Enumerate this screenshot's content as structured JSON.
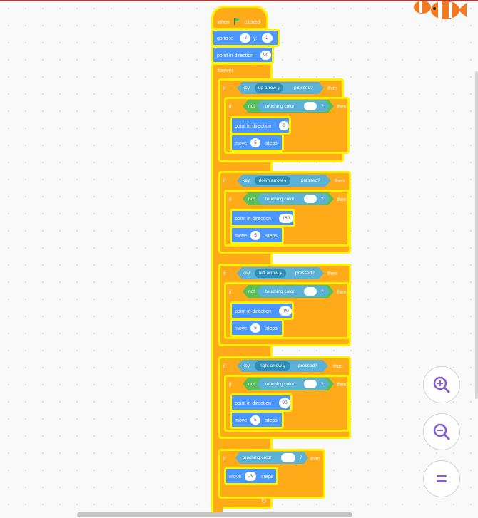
{
  "sprite": {
    "icon": "clownfish-icon"
  },
  "script": {
    "hat": {
      "when": "when",
      "flag_icon": "green-flag-icon",
      "clicked": "clicked"
    },
    "goto": {
      "label_x": "go to x:",
      "x": "-7",
      "label_y": "y:",
      "y": "2"
    },
    "point0": {
      "label": "point in direction",
      "value": "90"
    },
    "forever": {
      "label": "forever"
    },
    "if_labels": {
      "if": "if",
      "then": "then",
      "not": "not",
      "touching_color": "touching color",
      "q": "?",
      "key": "key",
      "pressed": "pressed?"
    },
    "blocks": [
      {
        "key": "up arrow",
        "direction": "0",
        "steps": "5"
      },
      {
        "key": "down arrow",
        "direction": "180",
        "steps": "5"
      },
      {
        "key": "left arrow",
        "direction": "-90",
        "steps": "5"
      },
      {
        "key": "right arrow",
        "direction": "90",
        "steps": "5"
      }
    ],
    "point_label": "point in direction",
    "move_label": "move",
    "steps_label": "steps",
    "final": {
      "move_value": "-3"
    }
  },
  "colors": {
    "control": "#ffab19",
    "motion": "#4c97ff",
    "sensing": "#5cb1d6",
    "operator": "#59c059",
    "highlight": "#fff200"
  },
  "zoom": {
    "in_icon": "zoom-in-icon",
    "out_icon": "zoom-out-icon",
    "reset_icon": "zoom-reset-icon"
  }
}
